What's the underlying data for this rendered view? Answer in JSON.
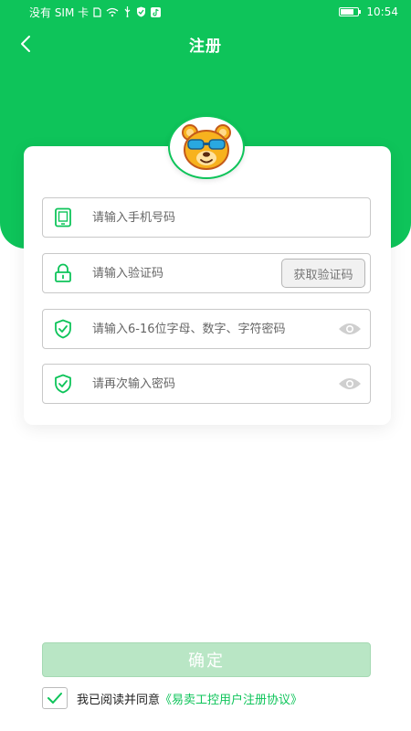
{
  "status_bar": {
    "carrier": "没有 SIM 卡",
    "time": "10:54"
  },
  "header": {
    "title": "注册"
  },
  "form": {
    "phone_placeholder": "请输入手机号码",
    "code_placeholder": "请输入验证码",
    "get_code_label": "获取验证码",
    "password_placeholder": "请输入6-16位字母、数字、字符密码",
    "confirm_password_placeholder": "请再次输入密码"
  },
  "actions": {
    "confirm_label": "确定"
  },
  "agreement": {
    "checked": true,
    "text": "我已阅读并同意",
    "link": "《易卖工控用户注册协议》"
  },
  "colors": {
    "primary": "#0ec45a",
    "button_disabled": "#b9e6c5"
  },
  "icons": {
    "phone": "phone-icon",
    "lock": "lock-icon",
    "shield": "shield-check-icon",
    "eye": "eye-icon",
    "back": "chevron-left-icon",
    "avatar": "bear-avatar"
  }
}
